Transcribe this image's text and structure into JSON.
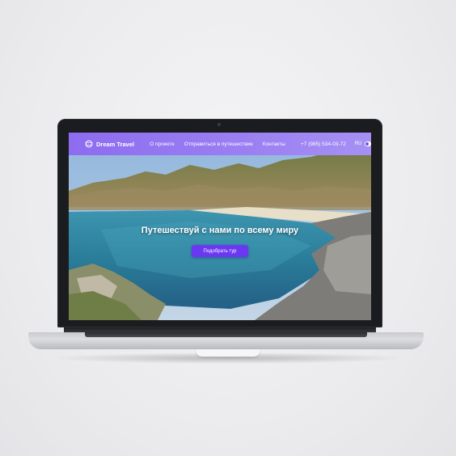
{
  "nav": {
    "logo_text": "Dream Travel",
    "links": [
      "О проекте",
      "Отправиться в путешествие",
      "Контакты"
    ],
    "phone": "+7 (985) 534-03-72",
    "language": "RU"
  },
  "hero": {
    "headline": "Путешествуй с нами по всему миру",
    "cta_label": "Подобрать тур"
  },
  "colors": {
    "nav_gradient_start": "#8d6cf0",
    "nav_gradient_end": "#a690f4",
    "cta": "#6a38f0",
    "laptop_frame": "#1b1c1f"
  },
  "icons": {
    "logo": "globe-icon",
    "language_toggle": "toggle-switch"
  }
}
